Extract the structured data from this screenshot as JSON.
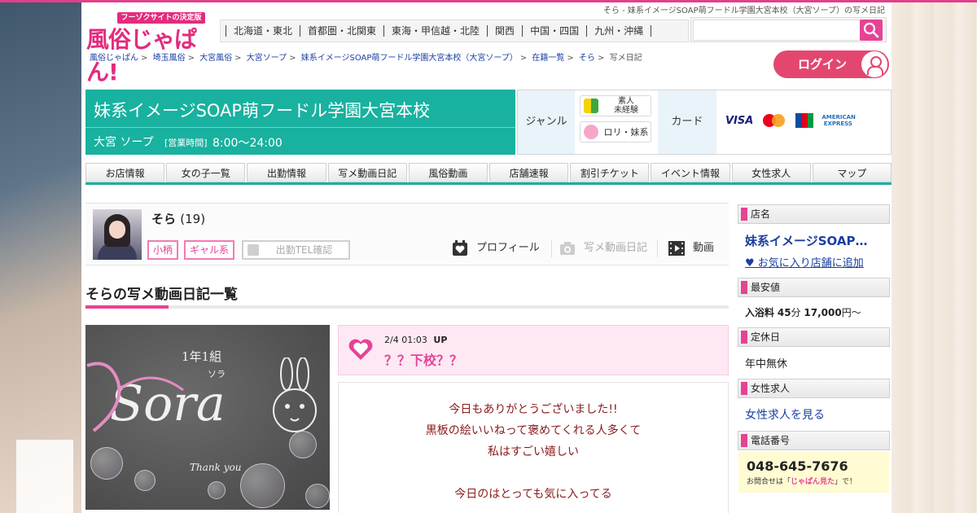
{
  "page": {
    "title_small": "そら - 妹系イメージSOAP萌フードル学園大宮本校（大宮ソープ）の写メ日記",
    "logo_tag": "フーゾクサイトの決定版",
    "logo_name": "風俗じゃぱん!"
  },
  "regions": [
    "北海道・東北",
    "首都圏・北関東",
    "東海・甲信越・北陸",
    "関西",
    "中国・四国",
    "九州・沖縄"
  ],
  "search": {
    "placeholder": ""
  },
  "breadcrumb": [
    "風俗じゃぱん",
    "埼玉風俗",
    "大宮風俗",
    "大宮ソープ",
    "妹系イメージSOAP萌フードル学園大宮本校（大宮ソープ）",
    "在籍一覧",
    "そら",
    "写メ日記"
  ],
  "login_label": "ログイン",
  "shop": {
    "name": "妹系イメージSOAP萌フードル学園大宮本校",
    "area": "大宮 ソープ",
    "hours_label": "[営業時間]",
    "hours": "8:00～24:00",
    "genre_label": "ジャンル",
    "genres": [
      {
        "label": "素人\n未経験",
        "l1": "素人",
        "l2": "未経験"
      },
      {
        "label": "ロリ・妹系"
      }
    ],
    "card_label": "カード",
    "cards": [
      "VISA",
      "MasterCard",
      "JCB",
      "AMERICAN EXPRESS"
    ]
  },
  "tabs": [
    "お店情報",
    "女の子一覧",
    "出勤情報",
    "写メ動画日記",
    "風俗動画",
    "店舗速報",
    "割引チケット",
    "イベント情報",
    "女性求人",
    "マップ"
  ],
  "girl": {
    "name": "そら",
    "age": "(19)",
    "tags": [
      "小柄",
      "ギャル系"
    ],
    "tel_button": "出勤TEL確認",
    "nav": [
      "プロフィール",
      "写メ動画日記",
      "動画"
    ]
  },
  "section_title": "そらの写メ動画日記一覧",
  "entry": {
    "date": "2/4",
    "time": "01:03",
    "up": "UP",
    "title": "？？下校？？",
    "body": [
      "今日もありがとうございました!!",
      "黒板の絵いいねって褒めてくれる人多くて",
      "私はすごい嬉しい",
      "今日のはとっても気に入ってる"
    ],
    "photo_text": {
      "class": "1年1組",
      "name": "ソラ",
      "big": "Sora",
      "thanks": "Thank you"
    }
  },
  "sidebar": {
    "shop_h": "店名",
    "shop_name": "妹系イメージSOAP…",
    "fav": "♥ お気に入り店舗に追加",
    "price_h": "最安値",
    "price_label": "入浴料",
    "price_min": "45",
    "price_unit": "分",
    "price_val": "17,000",
    "price_yen": "円～",
    "holiday_h": "定休日",
    "holiday": "年中無休",
    "recruit_h": "女性求人",
    "recruit_link": "女性求人を見る",
    "tel_h": "電話番号",
    "tel": "048-645-7676",
    "tel_note_pre": "お問合せは「",
    "tel_note_em": "じゃぱん見た",
    "tel_note_post": "」で！"
  },
  "colors": {
    "accent": "#e64394",
    "teal": "#19b19f",
    "link": "#1a3fa3"
  }
}
